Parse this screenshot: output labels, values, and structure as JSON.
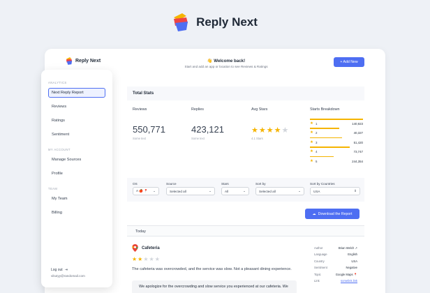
{
  "brand": {
    "name": "Reply Next"
  },
  "header": {
    "app_name": "Reply Next",
    "welcome_title": "👋 Welcome back!",
    "welcome_sub": "Start and add an app or location to see Reviews & Ratings",
    "add_button": "+ Add New"
  },
  "sidebar": {
    "section_analytics": "ANALYTICS",
    "analytics_items": [
      "Next Reply Report",
      "Reviews",
      "Ratings",
      "Sentiment"
    ],
    "section_account": "MY ACCOUNT",
    "account_items": [
      "Manage Sources",
      "Profile"
    ],
    "section_team": "TEAM",
    "team_items": [
      "My Team",
      "Billing"
    ],
    "logout": "Log out",
    "email": "vikutyy@randomail.com"
  },
  "stats": {
    "title": "Total Stats",
    "reviews_label": "Reviews",
    "reviews_value": "550,771",
    "reviews_note": "Some text",
    "replies_label": "Replies",
    "replies_value": "423,121",
    "replies_note": "Some text",
    "avg_label": "Avg Stars",
    "avg_note": "4.1 Stars",
    "avg_rating": 4,
    "breakdown_label": "Starts Breakdown",
    "breakdown": [
      {
        "star": "1",
        "count": "140,923",
        "fraction": 1.0
      },
      {
        "star": "2",
        "count": "40,327",
        "fraction": 0.55
      },
      {
        "star": "3",
        "count": "51,420",
        "fraction": 0.6
      },
      {
        "star": "4",
        "count": "73,747",
        "fraction": 0.75
      },
      {
        "star": "5",
        "count": "244,354",
        "fraction": 0.45
      }
    ]
  },
  "filters": {
    "os_label": "OS",
    "os_value": "A 🍎 📍",
    "source_label": "Source",
    "source_value": "Selected all",
    "stars_label": "Stars",
    "stars_value": "All",
    "sortby_label": "Sort by",
    "sortby_value": "Selected all",
    "countries_label": "Sort by Countries",
    "countries_value": "USA"
  },
  "download_button": "Download the Report",
  "review": {
    "group": "Today",
    "place": "Cafeteria",
    "rating": 2,
    "text": "The cafeteria was overcrowded, and the service was slow. Not a pleasant dining experience.",
    "reply": "We apologize for the overcrowding and slow service you experienced at our cafeteria. We",
    "meta": [
      {
        "key": "Author",
        "value": "Brian Welch ↗"
      },
      {
        "key": "Language",
        "value": "English"
      },
      {
        "key": "Country",
        "value": "USA"
      },
      {
        "key": "Sentiment",
        "value": "Negative"
      },
      {
        "key": "Topic",
        "value": "Google Maps 📍"
      },
      {
        "key": "Link",
        "value": "somelink.link"
      }
    ]
  },
  "colors": {
    "accent": "#4e6ef2",
    "star": "#f5b400"
  }
}
